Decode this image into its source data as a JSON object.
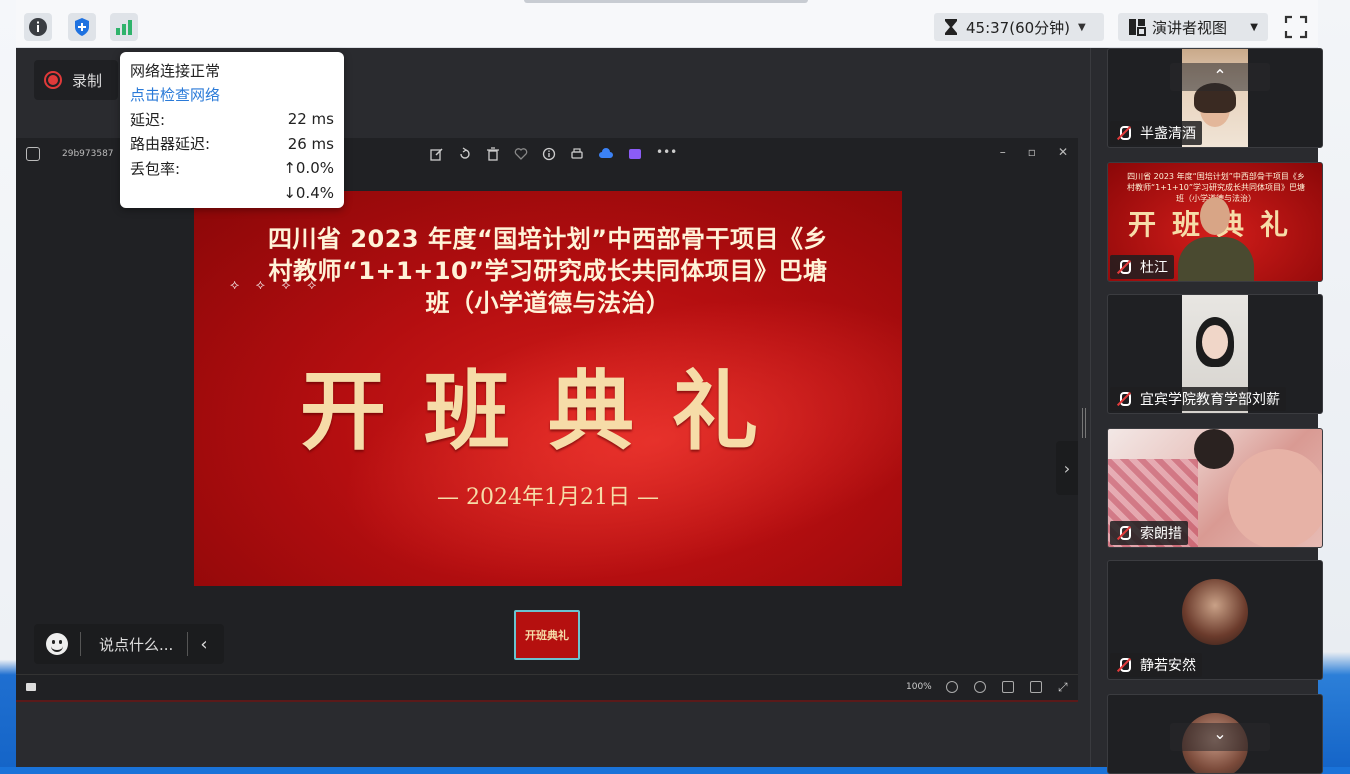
{
  "toolbar": {
    "timer": "45:37(60分钟)",
    "view_mode": "演讲者视图"
  },
  "record": {
    "label": "录制"
  },
  "network": {
    "status": "网络连接正常",
    "check_link": "点击检查网络",
    "latency_label": "延迟:",
    "latency_value": "22 ms",
    "router_label": "路由器延迟:",
    "router_value": "26 ms",
    "loss_label": "丢包率:",
    "loss_up": "↑0.0%",
    "loss_down": "↓0.4%"
  },
  "viewer": {
    "file_name": "29b973587",
    "zoom": "100%"
  },
  "slide": {
    "title_line1": "四川省 2023 年度“国培计划”中西部骨干项目《乡",
    "title_line2": "村教师“1+1+10”学习研究成长共同体项目》巴塘",
    "title_line3": "班（小学道德与法治）",
    "headline": "开班典礼",
    "date": "—   2024年1月21日   —",
    "thumb_text": "开班典礼"
  },
  "chat": {
    "placeholder": "说点什么..."
  },
  "participants": [
    {
      "name": "半盏清酒"
    },
    {
      "name": "杜江"
    },
    {
      "name": "宜宾学院教育学部刘薪"
    },
    {
      "name": "索朗措"
    },
    {
      "name": "静若安然"
    },
    {
      "name": ""
    }
  ],
  "colors": {
    "accent_link": "#2a7ad8",
    "slide_red": "#b40e10",
    "gold_text": "#f6dca8",
    "signal_green": "#2fb36b",
    "shield_blue": "#1f72e0"
  },
  "icons": [
    "info-icon",
    "shield-icon",
    "signal-icon",
    "hourglass-icon",
    "layout-icon",
    "fullscreen-icon",
    "mic-off-icon",
    "emoji-icon",
    "chevron-left-icon",
    "chevron-right-icon",
    "chevron-up-icon"
  ]
}
